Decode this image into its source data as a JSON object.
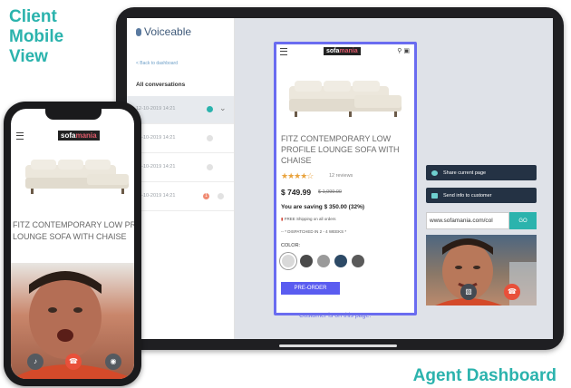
{
  "captions": {
    "client": [
      "Client",
      "Mobile",
      "View"
    ],
    "agent": "Agent Dashboard"
  },
  "sidebar": {
    "brand": "Voiceable",
    "back": "< Back to dashboard",
    "title": "All conversations",
    "conversations": [
      {
        "time": "12-10-2019  14:21",
        "status": "active"
      },
      {
        "time": "12-10-2019  14:21",
        "status": "idle"
      },
      {
        "time": "12-10-2019  14:21",
        "status": "idle"
      },
      {
        "time": "12-10-2019  14:21",
        "status": "alert",
        "badge": "1"
      }
    ]
  },
  "product": {
    "logo_a": "sofa",
    "logo_b": "mania",
    "title": "FITZ CONTEMPORARY LOW PROFILE LOUNGE SOFA WITH CHAISE",
    "stars": "★★★★☆",
    "reviews": "12 reviews",
    "price": "$ 749.99",
    "old_price": "$ 1,099.00",
    "saving": "You are saving $ 350.00 (32%)",
    "shipping": "FREE Shipping on all orders",
    "dispatch": "* DISPATCHED IN 2 - 4 WEEKS *",
    "color_label": "COLOR:",
    "swatches": [
      "#d9d9d9",
      "#4a4a4a",
      "#9a9a9a",
      "#2d4a66",
      "#5a5a5a"
    ],
    "preorder": "PRE-ORDER"
  },
  "status_text": "Customer is on this page.",
  "agent": {
    "share_label": "Share current page",
    "send_label": "Send info to customer",
    "url_value": "www.sofamania.com/col",
    "go_label": "GO"
  },
  "phone": {
    "title": "FITZ CONTEMPORARY LOW PROFILE LOUNGE SOFA WITH CHAISE"
  },
  "colors": {
    "accent": "#2bb3ad",
    "highlight": "#6a6cf0",
    "navy": "#243244",
    "end_call": "#e8503a"
  }
}
